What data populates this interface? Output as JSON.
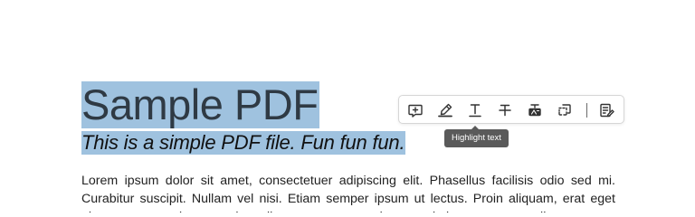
{
  "document": {
    "title": "Sample PDF",
    "subtitle": "This is a simple PDF file. Fun fun fun.",
    "body": "Lorem ipsum dolor sit amet, consectetuer adipiscing elit. Phasellus facilisis odio sed mi. Curabitur suscipit. Nullam vel nisi. Etiam semper ipsum ut lectus. Proin aliquam, erat eget pharetra commodo, eros mi condimentum quam, sed commodo justo quam ut velit."
  },
  "selection": {
    "highlight_color": "#9fc2df"
  },
  "toolbar": {
    "tools": [
      {
        "icon": "add-comment-icon"
      },
      {
        "icon": "highlight-pen-icon"
      },
      {
        "icon": "underline-text-icon"
      },
      {
        "icon": "strikethrough-text-icon"
      },
      {
        "icon": "replace-text-icon"
      },
      {
        "icon": "copy-text-icon"
      },
      {
        "icon": "more-options-icon"
      }
    ]
  },
  "tooltip": {
    "label": "Highlight text"
  }
}
